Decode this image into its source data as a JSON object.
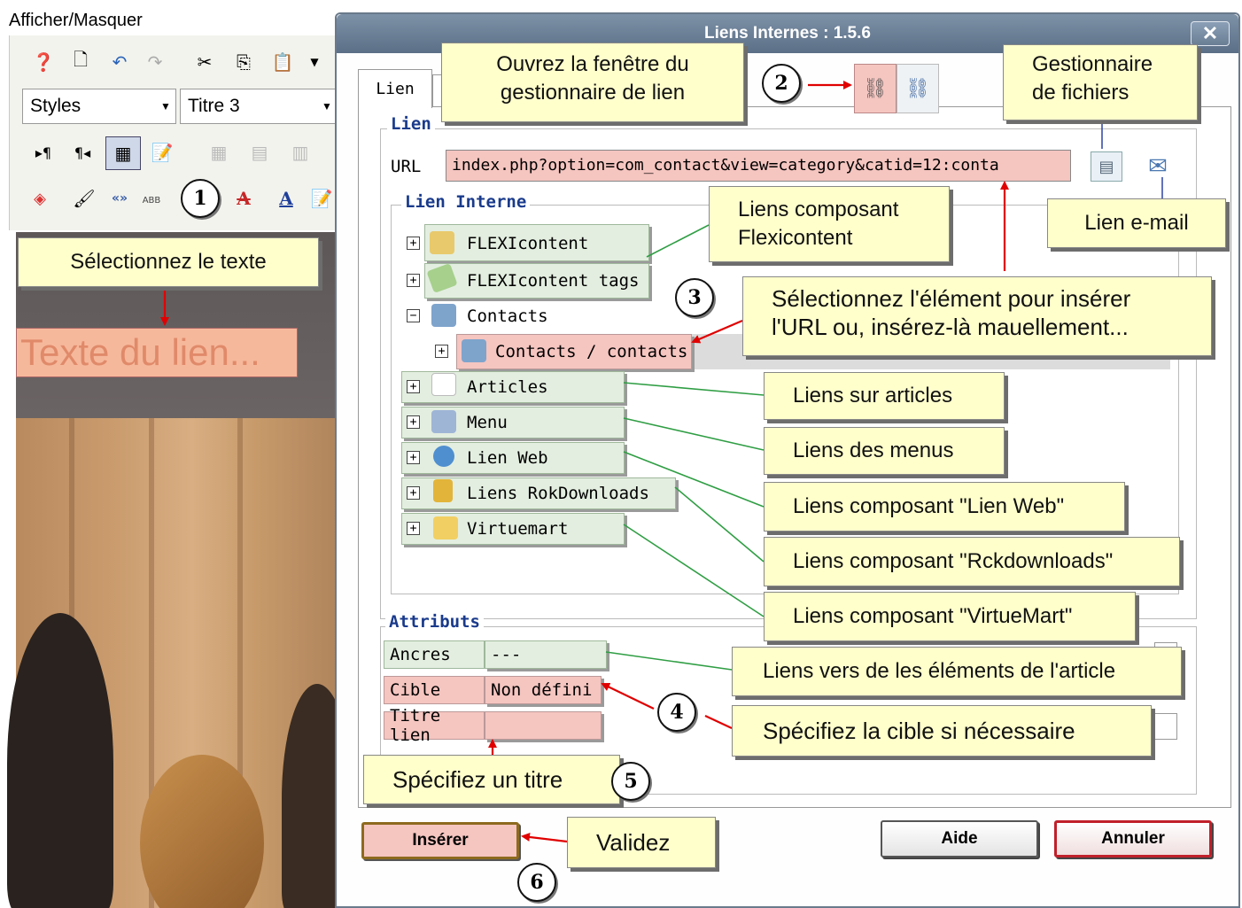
{
  "editor": {
    "toggle_label": "Afficher/Masquer",
    "styles_select": "Styles",
    "heading_select": "Titre 3",
    "selected_text": "Texte du lien..."
  },
  "dialog": {
    "title": "Liens Internes : 1.5.6",
    "close_label": "✕",
    "tab_link": "Lien",
    "section_link": "Lien",
    "url_label": "URL",
    "url_value": "index.php?option=com_contact&view=category&catid=12:conta",
    "section_internal": "Lien Interne",
    "tree": [
      {
        "label": "FLEXIcontent",
        "toggle": "+",
        "icon_color": "#e8c96b"
      },
      {
        "label": "FLEXIcontent tags",
        "toggle": "+",
        "icon_color": "#a6d08c"
      },
      {
        "label": "Contacts",
        "toggle": "−",
        "icon_color": "#7ea4cc"
      },
      {
        "label": "Contacts / contacts",
        "toggle": "+",
        "icon_color": "#7ea4cc"
      },
      {
        "label": "Articles",
        "toggle": "+",
        "icon_color": "#dddddd"
      },
      {
        "label": "Menu",
        "toggle": "+",
        "icon_color": "#9fb5d6"
      },
      {
        "label": "Lien Web",
        "toggle": "+",
        "icon_color": "#4f8fd0"
      },
      {
        "label": "Liens RokDownloads",
        "toggle": "+",
        "icon_color": "#e2b43a"
      },
      {
        "label": "Virtuemart",
        "toggle": "+",
        "icon_color": "#f2cf62"
      }
    ],
    "section_attributes": "Attributs",
    "attributes": {
      "anchors_label": "Ancres",
      "anchors_value": "---",
      "target_label": "Cible",
      "target_value": "Non défini",
      "title_label": "Titre lien",
      "title_value": ""
    },
    "buttons": {
      "insert": "Insérer",
      "help": "Aide",
      "cancel": "Annuler"
    }
  },
  "callouts": {
    "select_text": "Sélectionnez le texte",
    "open_manager": [
      "Ouvrez la fenêtre du",
      "gestionnaire de lien"
    ],
    "file_manager": [
      "Gestionnaire",
      "de fichiers"
    ],
    "flexicontent": [
      "Liens composant",
      "Flexicontent"
    ],
    "email_link": "Lien e-mail",
    "select_element": [
      "Sélectionnez l'élément pour insérer",
      "l'URL ou, insérez-là mauellement..."
    ],
    "articles": "Liens sur articles",
    "menus": "Liens des menus",
    "weblink": "Liens composant \"Lien Web\"",
    "rokdownloads": "Liens composant \"Rckdownloads\"",
    "virtuemart": "Liens composant \"VirtueMart\"",
    "anchors": "Liens vers de les éléments de l'article",
    "target": "Spécifiez la cible si nécessaire",
    "title": "Spécifiez un titre",
    "validate": "Validez"
  },
  "steps": [
    "1",
    "2",
    "3",
    "4",
    "5",
    "6"
  ],
  "colors": {
    "callout_bg": "#ffffcc",
    "highlight_pink": "#f5c5c0",
    "tree_green": "#e3eee0",
    "arrow_red": "#e00000",
    "line_green": "#2f9e44",
    "titlebar": "#6a7e94",
    "legend_blue": "#1a3b8c"
  }
}
